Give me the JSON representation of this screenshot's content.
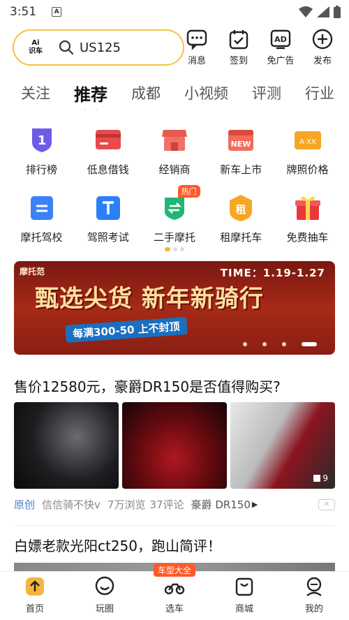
{
  "status": {
    "time": "3:51",
    "app_icon": "A"
  },
  "search": {
    "logo_top": "Ai",
    "logo_bottom": "识车",
    "value": "US125"
  },
  "top_actions": [
    {
      "label": "消息",
      "icon": "message-icon"
    },
    {
      "label": "签到",
      "icon": "checkin-icon"
    },
    {
      "label": "免广告",
      "icon": "ad-free-icon"
    },
    {
      "label": "发布",
      "icon": "publish-icon"
    }
  ],
  "tabs": [
    "关注",
    "推荐",
    "成都",
    "小视频",
    "评测",
    "行业"
  ],
  "active_tab": "推荐",
  "grid": {
    "row1": [
      {
        "label": "排行榜",
        "icon": "ranking-icon"
      },
      {
        "label": "低息借钱",
        "icon": "loan-icon"
      },
      {
        "label": "经销商",
        "icon": "dealer-icon"
      },
      {
        "label": "新车上市",
        "icon": "new-car-icon"
      },
      {
        "label": "牌照价格",
        "icon": "license-price-icon"
      }
    ],
    "row2": [
      {
        "label": "摩托驾校",
        "icon": "driving-school-icon"
      },
      {
        "label": "驾照考试",
        "icon": "license-exam-icon"
      },
      {
        "label": "二手摩托",
        "icon": "used-moto-icon",
        "badge": "热门"
      },
      {
        "label": "租摩托车",
        "icon": "rent-moto-icon"
      },
      {
        "label": "免费抽车",
        "icon": "free-draw-icon"
      }
    ]
  },
  "banner": {
    "brand": "摩托范",
    "time": "TIME：1.19-1.27",
    "title": "甄选尖货 新年新骑行",
    "subtitle": "每满300-50 上不封顶"
  },
  "article1": {
    "title": "售价12580元，豪爵DR150是否值得购买?",
    "image_count": "9",
    "tag": "原创",
    "author": "信信骑不快v",
    "views": "7万浏览",
    "comments": "37评论",
    "model": "豪爵 DR150"
  },
  "article2": {
    "title": "白嫖老款光阳ct250，跑山简评！"
  },
  "bottom_nav": [
    {
      "label": "首页",
      "icon": "home-icon"
    },
    {
      "label": "玩圈",
      "icon": "circle-icon"
    },
    {
      "label": "选车",
      "icon": "motorcycle-icon",
      "badge": "车型大全"
    },
    {
      "label": "商城",
      "icon": "shop-icon"
    },
    {
      "label": "我的",
      "icon": "profile-icon"
    }
  ],
  "colors": {
    "accent": "#f3b63d",
    "search_border": "#f3c241",
    "hot": "#ff5a2a",
    "link": "#4a7fd0"
  }
}
